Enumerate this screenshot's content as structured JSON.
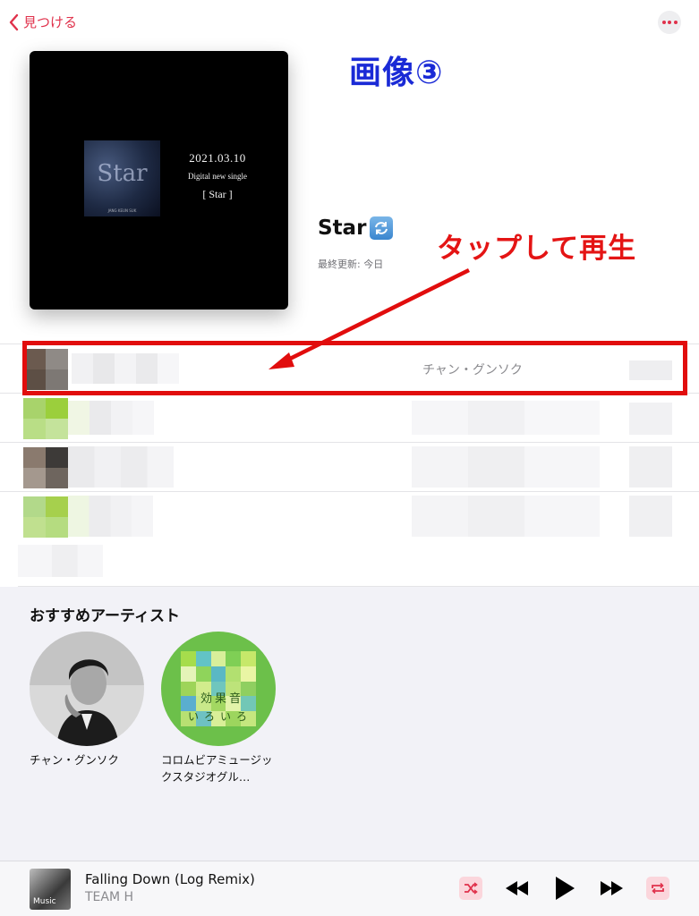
{
  "nav": {
    "back_label": "見つける"
  },
  "annotations": {
    "title": "画像③",
    "tap_hint": "タップして再生"
  },
  "cover": {
    "date": "2021.03.10",
    "subtitle": "Digital new single",
    "title": "Star",
    "art_word": "Star",
    "art_small": "JANG KEUN SUK"
  },
  "playlist": {
    "title": "Star",
    "updated": "最終更新: 今日",
    "badge_icon": "sync-icon"
  },
  "tracks": [
    {
      "artist": "チャン・グンソク",
      "highlighted": true
    },
    {
      "artist": ""
    },
    {
      "artist": ""
    },
    {
      "artist": ""
    }
  ],
  "recommended": {
    "heading": "おすすめアーティスト",
    "artists": [
      {
        "name": "チャン・グンソク"
      },
      {
        "name": "コロムビアミュージックスタジオグル…"
      }
    ],
    "effects_art": {
      "line1": "効果音",
      "line2": "いろいろ"
    }
  },
  "now_playing": {
    "title": "Falling Down (Log Remix)",
    "artist": "TEAM H",
    "art_text": "Music"
  },
  "colors": {
    "accent": "#e0314b",
    "annotation_blue": "#1a2ad6",
    "annotation_red": "#e41414"
  },
  "icons": [
    "chevron-left-icon",
    "more-icon",
    "sync-icon",
    "shuffle-icon",
    "rewind-icon",
    "play-icon",
    "fast-forward-icon",
    "repeat-icon"
  ]
}
